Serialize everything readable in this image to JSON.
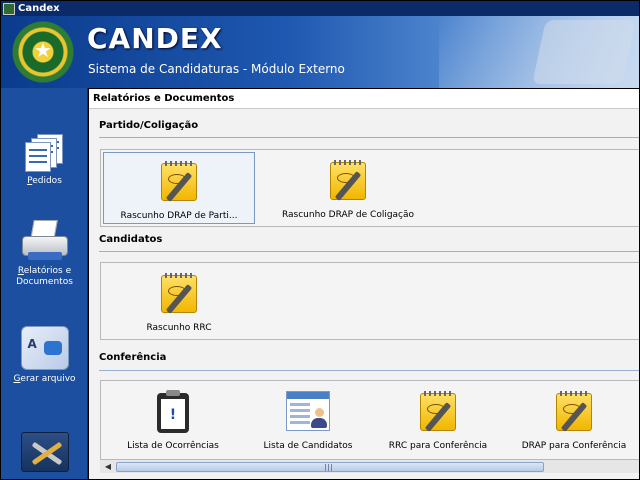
{
  "window": {
    "title": "Candex",
    "icon": "app-icon"
  },
  "header": {
    "title": "CANDEX",
    "subtitle": "Sistema de Candidaturas - Módulo Externo",
    "crest_icon": "brazil-coat-of-arms-icon"
  },
  "sidebar": {
    "items": [
      {
        "label_key": "P",
        "label_rest": "edidos",
        "icon": "documents-icon"
      },
      {
        "label_key": "R",
        "label_rest": "elatórios e",
        "label_line2": "Documentos",
        "icon": "printer-icon"
      },
      {
        "label_key": "G",
        "label_rest": "erar arquivo",
        "icon": "generate-file-icon"
      },
      {
        "icon": "tools-icon"
      }
    ]
  },
  "main": {
    "page_title": "Relatórios e Documentos",
    "sections": [
      {
        "heading": "Partido/Coligação",
        "tiles": [
          {
            "label": "Rascunho DRAP de Parti...",
            "icon": "notepad-icon",
            "selected": true
          },
          {
            "label": "Rascunho DRAP de Coligação",
            "icon": "notepad-icon",
            "selected": false
          }
        ]
      },
      {
        "heading": "Candidatos",
        "tiles": [
          {
            "label": "Rascunho RRC",
            "icon": "notepad-icon",
            "selected": false
          }
        ]
      },
      {
        "heading": "Conferência",
        "tiles": [
          {
            "label": "Lista de Ocorrências",
            "icon": "clipboard-alert-icon",
            "selected": false
          },
          {
            "label": "Lista de Candidatos",
            "icon": "candidate-list-icon",
            "selected": false
          },
          {
            "label": "RRC para Conferência",
            "icon": "notepad-icon",
            "selected": false
          },
          {
            "label": "DRAP para Conferência",
            "icon": "notepad-icon",
            "selected": false
          }
        ]
      }
    ]
  },
  "colors": {
    "titlebar": "#0a2a6a",
    "sidebar": "#1c4fa0",
    "header_start": "#0b3b8c",
    "selection_border": "#7a98c2"
  }
}
